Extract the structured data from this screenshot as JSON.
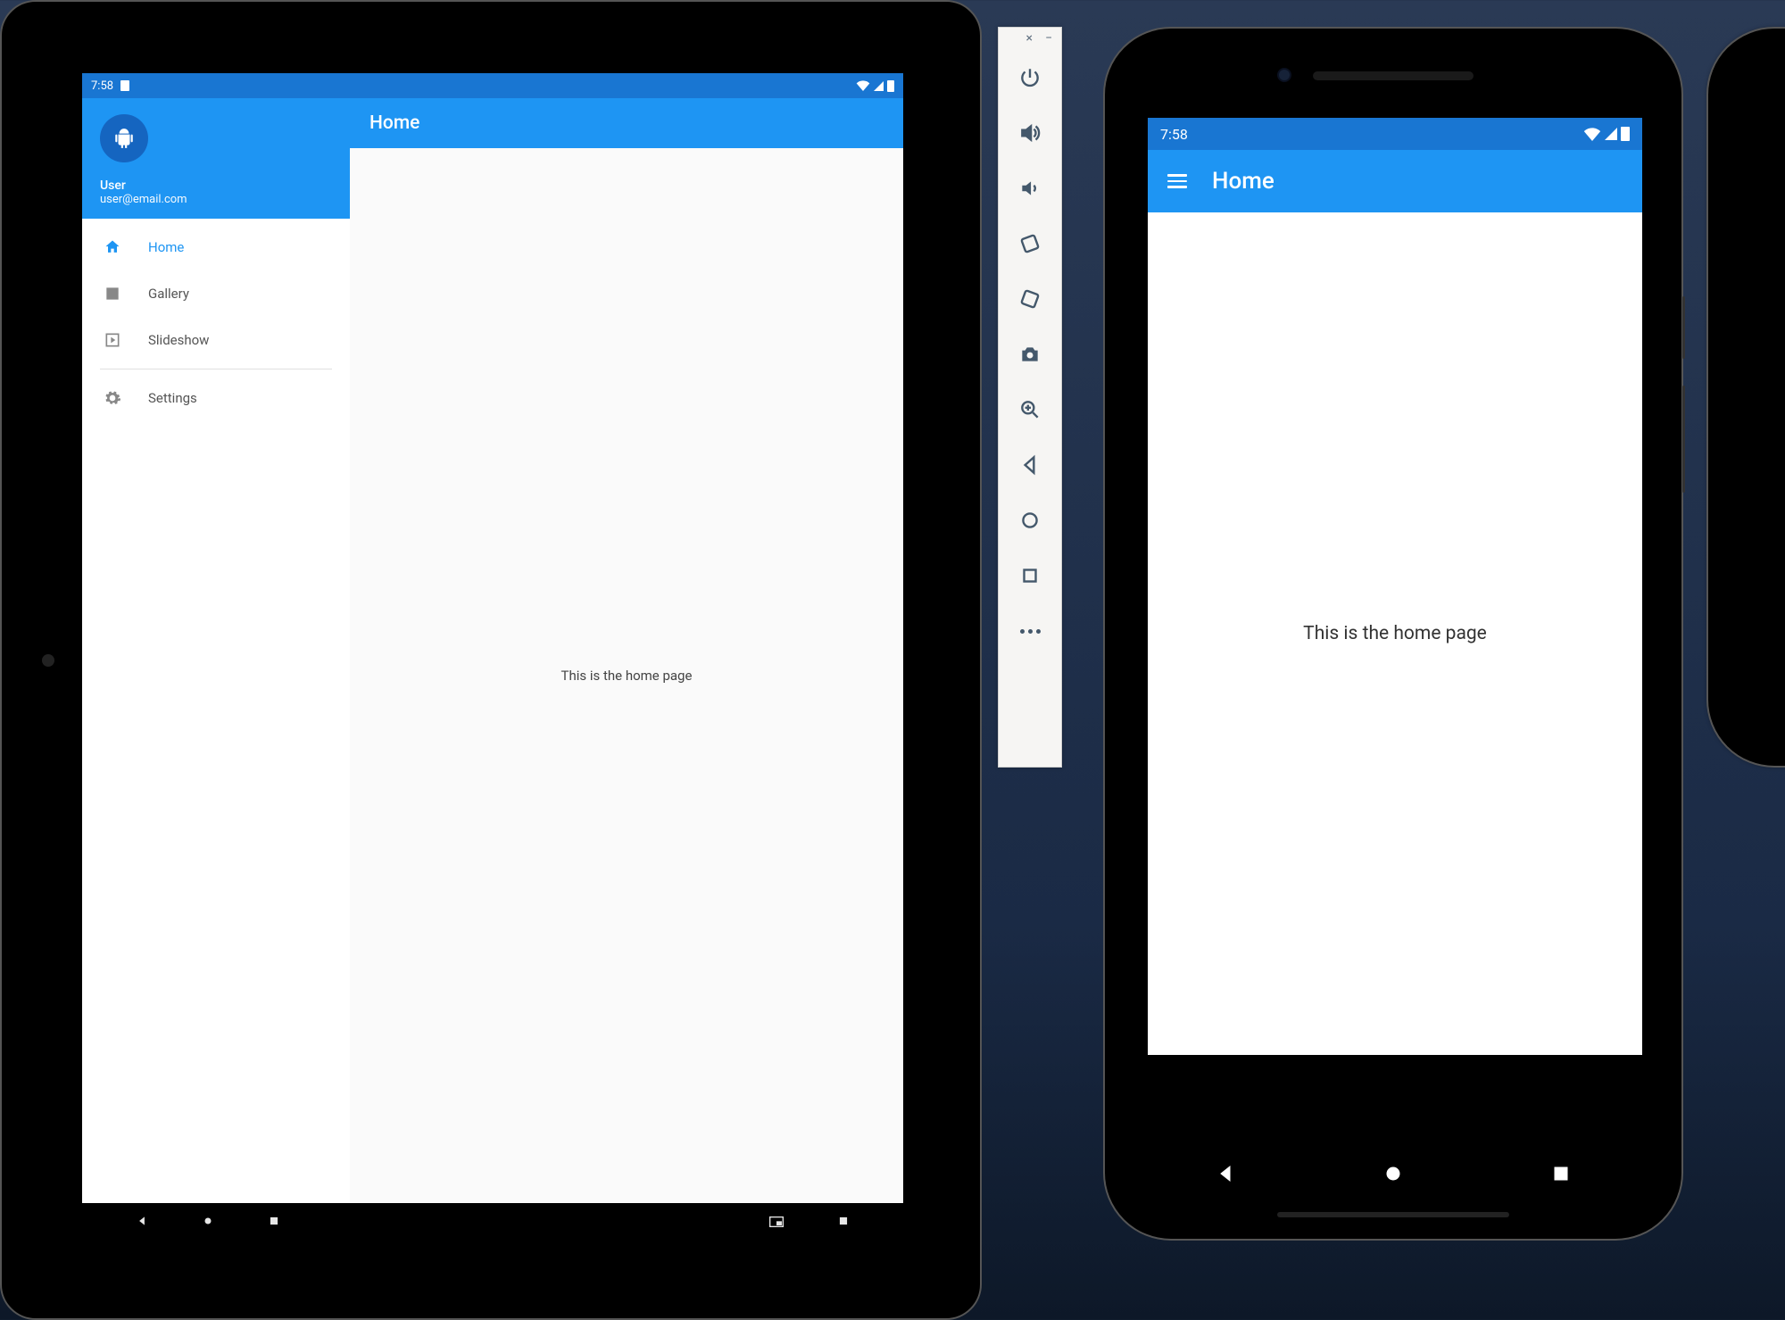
{
  "status": {
    "time": "7:58"
  },
  "drawer": {
    "user_name": "User",
    "user_email": "user@email.com",
    "items": [
      {
        "icon": "home-icon",
        "label": "Home",
        "active": true
      },
      {
        "icon": "gallery-icon",
        "label": "Gallery",
        "active": false
      },
      {
        "icon": "slideshow-icon",
        "label": "Slideshow",
        "active": false
      }
    ],
    "secondary": [
      {
        "icon": "gear-icon",
        "label": "Settings"
      }
    ]
  },
  "appbar": {
    "title": "Home"
  },
  "content": {
    "home_text": "This is the home page"
  },
  "phone": {
    "appbar_title": "Home",
    "content_text": "This is the home page"
  },
  "emu_toolbar": {
    "close": "×",
    "minimize": "−",
    "items": [
      "power-icon",
      "volume-up-icon",
      "volume-down-icon",
      "rotate-left-icon",
      "rotate-right-icon",
      "camera-icon",
      "zoom-in-icon",
      "back-icon",
      "home-circle-icon",
      "overview-icon",
      "more-icon"
    ]
  }
}
